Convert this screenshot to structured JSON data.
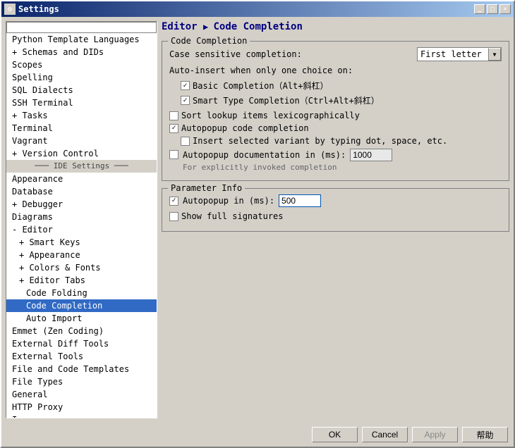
{
  "window": {
    "title": "Settings",
    "close_label": "✕",
    "minimize_label": "_",
    "maximize_label": "□"
  },
  "sidebar": {
    "search_placeholder": "",
    "items": [
      {
        "id": "python-template",
        "label": "Python Template Languages",
        "indent": 0,
        "expanded": false,
        "selected": false
      },
      {
        "id": "schemas-dids",
        "label": "+ Schemas and DIDs",
        "indent": 0,
        "expanded": false,
        "selected": false
      },
      {
        "id": "scopes",
        "label": "Scopes",
        "indent": 0,
        "selected": false
      },
      {
        "id": "spelling",
        "label": "Spelling",
        "indent": 0,
        "selected": false
      },
      {
        "id": "sql-dialects",
        "label": "SQL Dialects",
        "indent": 0,
        "selected": false
      },
      {
        "id": "ssh-terminal",
        "label": "SSH Terminal",
        "indent": 0,
        "selected": false
      },
      {
        "id": "tasks",
        "label": "+ Tasks",
        "indent": 0,
        "expanded": false,
        "selected": false
      },
      {
        "id": "terminal",
        "label": "Terminal",
        "indent": 0,
        "selected": false
      },
      {
        "id": "vagrant",
        "label": "Vagrant",
        "indent": 0,
        "selected": false
      },
      {
        "id": "version-control",
        "label": "+ Version Control",
        "indent": 0,
        "expanded": false,
        "selected": false
      },
      {
        "id": "ide-settings",
        "label": "─── IDE Settings ───",
        "group": true
      },
      {
        "id": "appearance-ide",
        "label": "Appearance",
        "indent": 0,
        "selected": false
      },
      {
        "id": "database",
        "label": "Database",
        "indent": 0,
        "selected": false
      },
      {
        "id": "debugger",
        "label": "+ Debugger",
        "indent": 0,
        "selected": false
      },
      {
        "id": "diagrams",
        "label": "Diagrams",
        "indent": 0,
        "selected": false
      },
      {
        "id": "editor",
        "label": "- Editor",
        "indent": 0,
        "selected": false,
        "expanded": true
      },
      {
        "id": "smart-keys",
        "label": "+ Smart Keys",
        "indent": 1,
        "selected": false
      },
      {
        "id": "appearance",
        "label": "+ Appearance",
        "indent": 1,
        "selected": false
      },
      {
        "id": "colors-fonts",
        "label": "+ Colors & Fonts",
        "indent": 1,
        "selected": false
      },
      {
        "id": "editor-tabs",
        "label": "+ Editor Tabs",
        "indent": 1,
        "selected": false
      },
      {
        "id": "code-folding",
        "label": "Code Folding",
        "indent": 2,
        "selected": false
      },
      {
        "id": "code-completion",
        "label": "Code Completion",
        "indent": 2,
        "selected": true
      },
      {
        "id": "auto-import",
        "label": "Auto Import",
        "indent": 2,
        "selected": false
      },
      {
        "id": "emmet",
        "label": "Emmet (Zen Coding)",
        "indent": 0,
        "selected": false
      },
      {
        "id": "external-diff",
        "label": "External Diff Tools",
        "indent": 0,
        "selected": false
      },
      {
        "id": "external-tools",
        "label": "External Tools",
        "indent": 0,
        "selected": false
      },
      {
        "id": "file-code-templates",
        "label": "File and Code Templates",
        "indent": 0,
        "selected": false
      },
      {
        "id": "file-types",
        "label": "File Types",
        "indent": 0,
        "selected": false
      },
      {
        "id": "general",
        "label": "General",
        "indent": 0,
        "selected": false
      },
      {
        "id": "http-proxy",
        "label": "HTTP Proxy",
        "indent": 0,
        "selected": false
      },
      {
        "id": "images",
        "label": "Images",
        "indent": 0,
        "selected": false
      }
    ]
  },
  "header": {
    "title": "Editor",
    "arrow": "▶",
    "subtitle": "Code Completion"
  },
  "code_completion_section": {
    "title": "Code Completion",
    "case_sensitive_label": "Case sensitive completion:",
    "case_sensitive_value": "First letter",
    "auto_insert_label": "Auto-insert when only one choice on:",
    "basic_completion_label": "Basic Completion（Alt+斜杠）",
    "basic_completion_checked": true,
    "smart_type_label": "Smart Type Completion（Ctrl+Alt+斜杠）",
    "smart_type_checked": true,
    "sort_lookup_label": "Sort lookup items lexicographically",
    "sort_lookup_checked": false,
    "autopopup_label": "Autopopup code completion",
    "autopopup_checked": true,
    "insert_variant_label": "Insert selected variant by typing dot, space, etc.",
    "insert_variant_checked": false,
    "autopopup_doc_label": "Autopopup documentation in (ms):",
    "autopopup_doc_checked": false,
    "autopopup_doc_hint": "For explicitly invoked completion",
    "autopopup_doc_value": "1000"
  },
  "parameter_info_section": {
    "title": "Parameter Info",
    "autopopup_label": "Autopopup in (ms):",
    "autopopup_checked": true,
    "autopopup_value": "500",
    "show_full_label": "Show full signatures",
    "show_full_checked": false
  },
  "buttons": {
    "ok": "OK",
    "cancel": "Cancel",
    "apply": "Apply",
    "help": "帮助"
  }
}
